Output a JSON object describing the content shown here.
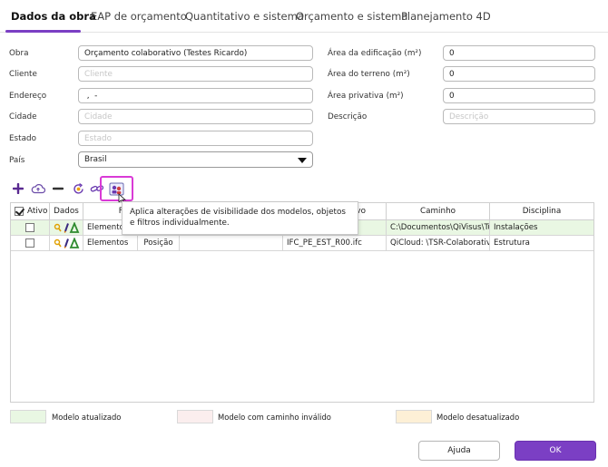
{
  "tabs": [
    {
      "label": "Dados da obra",
      "active": true
    },
    {
      "label": "EAP de orçamento",
      "active": false
    },
    {
      "label": "Quantitativo e sistema",
      "active": false
    },
    {
      "label": "Orçamento e sistema",
      "active": false
    },
    {
      "label": "Planejamento 4D",
      "active": false
    }
  ],
  "form": {
    "obra": {
      "label": "Obra",
      "value": "Orçamento colaborativo (Testes Ricardo)"
    },
    "cliente": {
      "label": "Cliente",
      "placeholder": "Cliente"
    },
    "endereco": {
      "label": "Endereço",
      "value": " ,  -"
    },
    "cidade": {
      "label": "Cidade",
      "placeholder": "Cidade"
    },
    "estado": {
      "label": "Estado",
      "placeholder": "Estado"
    },
    "pais": {
      "label": "País",
      "value": "Brasil"
    },
    "area_edificacao": {
      "label": "Área da edificação (m²)",
      "value": "0"
    },
    "area_terreno": {
      "label": "Área do terreno (m²)",
      "value": "0"
    },
    "area_privativa": {
      "label": "Área privativa (m²)",
      "value": "0"
    },
    "descricao": {
      "label": "Descrição",
      "placeholder": "Descrição"
    }
  },
  "toolbar": {
    "icons": [
      "plus-icon",
      "cloud-upload-icon",
      "minus-icon",
      "refresh-icon",
      "link-icon",
      "apply-visibility-icon"
    ],
    "accent": "#5a2a91",
    "highlight": "#d93ad6"
  },
  "tooltip": {
    "text": "Aplica alterações de visibilidade dos modelos, objetos e filtros individualmente."
  },
  "table": {
    "headers": {
      "ativo": "Ativo",
      "dados": "Dados",
      "filtro": "Filtro",
      "arquivo_tail": "vo",
      "caminho": "Caminho",
      "disciplina": "Disciplina"
    },
    "rows": [
      {
        "checked": false,
        "status": "updated",
        "filtro": "Elementos",
        "posicao": "",
        "arquivo": "",
        "caminho": "C:\\Documentos\\QiVisus\\Tu",
        "disciplina": "Instalações"
      },
      {
        "checked": false,
        "status": "normal",
        "filtro": "Elementos",
        "posicao": "Posição",
        "arquivo": "IFC_PE_EST_R00.ifc",
        "caminho": "QiCloud: \\TSR-Colaborativo",
        "disciplina": "Estrutura"
      }
    ]
  },
  "legend": [
    {
      "label": "Modelo atualizado",
      "color": "#e9f7e3"
    },
    {
      "label": "Modelo com caminho inválido",
      "color": "#fbeeee"
    },
    {
      "label": "Modelo desatualizado",
      "color": "#fdf0d6"
    }
  ],
  "buttons": {
    "help": "Ajuda",
    "ok": "OK"
  },
  "colors": {
    "accent": "#7b3fc4"
  }
}
